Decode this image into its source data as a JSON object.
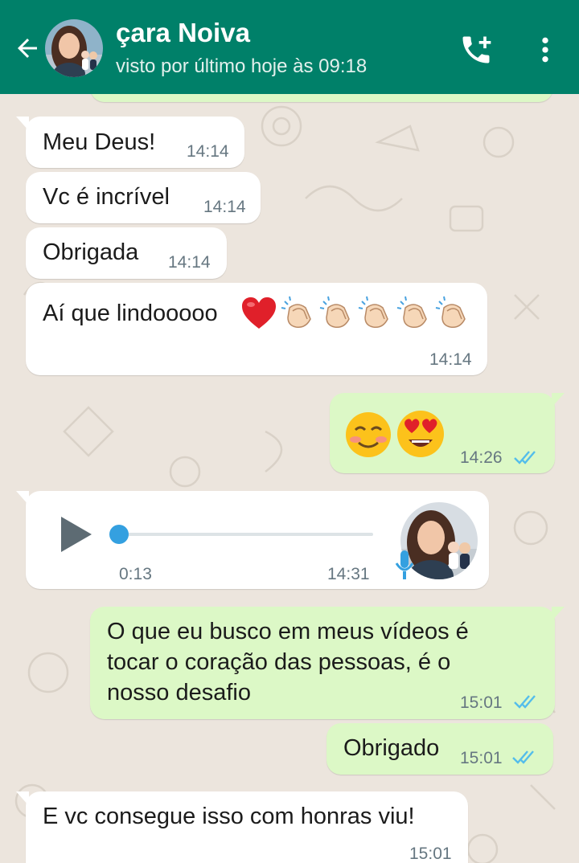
{
  "header": {
    "title": "çara Noiva",
    "status": "visto por último hoje às 09:18",
    "back_icon": "arrow-left-icon",
    "call_icon": "add-call-icon",
    "menu_icon": "more-vert-icon"
  },
  "colors": {
    "header": "#008069",
    "incoming_bubble": "#ffffff",
    "outgoing_bubble": "#dcf8c6",
    "read_ticks": "#53bdeb",
    "chat_bg": "#ece5dd"
  },
  "messages": [
    {
      "dir": "in",
      "text": "Meu Deus!",
      "time": "14:14"
    },
    {
      "dir": "in",
      "text": "Vc é incrível",
      "time": "14:14"
    },
    {
      "dir": "in",
      "text": "Obrigada",
      "time": "14:14"
    },
    {
      "dir": "in",
      "text": "Aí que lindooooo",
      "emojis": [
        "heart",
        "clap",
        "clap",
        "clap",
        "clap",
        "clap"
      ],
      "time": "14:14"
    },
    {
      "dir": "out",
      "emojis": [
        "smiling-blush",
        "heart-eyes"
      ],
      "time": "14:26",
      "status": "read"
    },
    {
      "dir": "in",
      "type": "voice",
      "duration": "0:13",
      "time": "14:31",
      "progress": 0
    },
    {
      "dir": "out",
      "lines": [
        "O que eu busco em meus vídeos é",
        "tocar o coração das pessoas, é o",
        "nosso desafio"
      ],
      "time": "15:01",
      "status": "read"
    },
    {
      "dir": "out",
      "text": "Obrigado",
      "time": "15:01",
      "status": "read"
    },
    {
      "dir": "in",
      "text": "E vc consegue isso com honras viu!",
      "time": "15:01"
    }
  ]
}
